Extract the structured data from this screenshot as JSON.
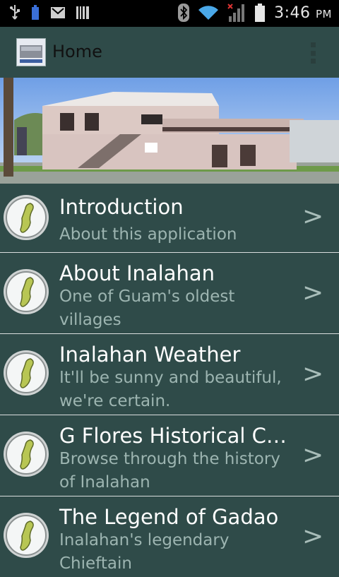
{
  "status_bar": {
    "time": "3:46",
    "ampm": "PM",
    "icons": [
      "usb-icon",
      "battery-small-icon",
      "gmail-icon",
      "barcode-icon",
      "bluetooth-icon",
      "wifi-icon",
      "signal-icon",
      "battery-icon"
    ]
  },
  "action_bar": {
    "title": "Home",
    "overflow_icon": "overflow-menu-icon"
  },
  "banner": {
    "image": "building-photo"
  },
  "list": [
    {
      "title": "Introduction",
      "subtitle": "About this application"
    },
    {
      "title": "About Inalahan",
      "subtitle": "One of Guam's oldest villages"
    },
    {
      "title": "Inalahan Weather",
      "subtitle": "It'll be sunny and beautiful, we're certain."
    },
    {
      "title": "G Flores Historical C…",
      "subtitle": "Browse through the history of Inalahan"
    },
    {
      "title": "The Legend of Gadao",
      "subtitle": "Inalahan's legendary Chieftain"
    }
  ],
  "chevron": ">"
}
